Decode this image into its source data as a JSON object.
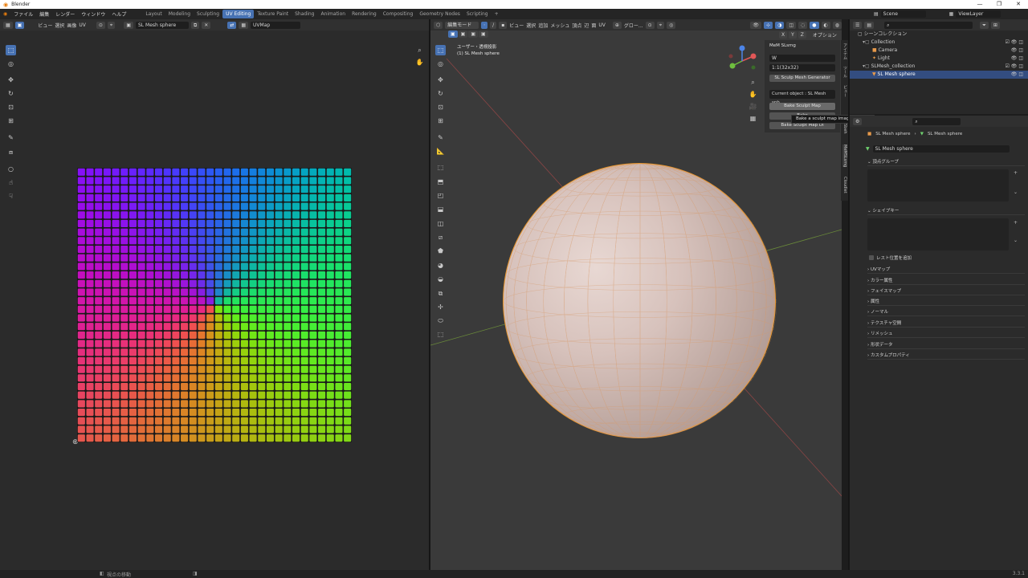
{
  "window_title": "Blender",
  "window_controls": [
    "—",
    "❐",
    "✕"
  ],
  "menu": [
    "ファイル",
    "編集",
    "レンダー",
    "ウィンドウ",
    "ヘルプ"
  ],
  "workspaces": [
    {
      "label": "Layout",
      "active": false
    },
    {
      "label": "Modeling",
      "active": false
    },
    {
      "label": "Sculpting",
      "active": false
    },
    {
      "label": "UV Editing",
      "active": true
    },
    {
      "label": "Texture Paint",
      "active": false
    },
    {
      "label": "Shading",
      "active": false
    },
    {
      "label": "Animation",
      "active": false
    },
    {
      "label": "Rendering",
      "active": false
    },
    {
      "label": "Compositing",
      "active": false
    },
    {
      "label": "Geometry Nodes",
      "active": false
    },
    {
      "label": "Scripting",
      "active": false
    }
  ],
  "add_workspace": "+",
  "scene": "Scene",
  "view_layer": "ViewLayer",
  "uv_header": {
    "menus": [
      "ビュー",
      "選択",
      "画像",
      "UV"
    ],
    "image_name": "SL Mesh sphere",
    "uvmap": "UVMap"
  },
  "v3d_header": {
    "mode": "編集モード",
    "menus": [
      "ビュー",
      "選択",
      "追加",
      "メッシュ",
      "頂点",
      "辺",
      "面",
      "UV"
    ],
    "orientation": "グロー...",
    "options": "オプション",
    "axes": [
      "X",
      "Y",
      "Z"
    ]
  },
  "viewport_overlay": {
    "line1": "ユーザー・透視投影",
    "line2": "(1) SL Mesh sphere"
  },
  "npanel": {
    "title": "MeM SLsmg",
    "dropdown1": "W",
    "dropdown2": "1:1(32x32)",
    "generator_btn": "SL Sculp Mesh Generator",
    "current_object": "Current object : SL Mesh sph",
    "bake_btn": "Bake Sculpt Map",
    "bake_btn2": "Bake",
    "bake_btn3": "Bake Sculpt Map Di",
    "tabs": [
      "アイテム",
      "ツール",
      "ビュー",
      "Sbeh",
      "MeMSLsmg",
      "Cloudlet"
    ]
  },
  "tooltip": "Bake a sculpt map image of Mesh.",
  "outliner": {
    "search_placeholder": "",
    "rows": [
      {
        "label": "シーンコレクション",
        "indent": 0,
        "icon": "collection-icon"
      },
      {
        "label": "Collection",
        "indent": 1,
        "icon": "collection-icon"
      },
      {
        "label": "Camera",
        "indent": 2,
        "icon": "camera-icon"
      },
      {
        "label": "Light",
        "indent": 2,
        "icon": "light-icon"
      },
      {
        "label": "SLMesh_collection",
        "indent": 1,
        "icon": "collection-icon"
      },
      {
        "label": "SL Mesh sphere",
        "indent": 2,
        "icon": "mesh-icon",
        "selected": true
      }
    ]
  },
  "properties": {
    "breadcrumb_obj": "SL Mesh sphere",
    "breadcrumb_data": "SL Mesh sphere",
    "data_name": "SL Mesh sphere",
    "sections": [
      "頂点グループ",
      "シェイプキー"
    ],
    "relative_label": "レスト位置を追加",
    "collapsed": [
      "UVマップ",
      "カラー属性",
      "フェイスマップ",
      "属性",
      "ノーマル",
      "テクスチャ空間",
      "リメッシュ",
      "形状データ",
      "カスタムプロパティ"
    ]
  },
  "status": {
    "left": "",
    "center": "視点の移動",
    "version": "3.3.1"
  },
  "colors": {
    "accent": "#4772b3",
    "edge": "#e8962e",
    "bg": "#2b2b2b"
  }
}
